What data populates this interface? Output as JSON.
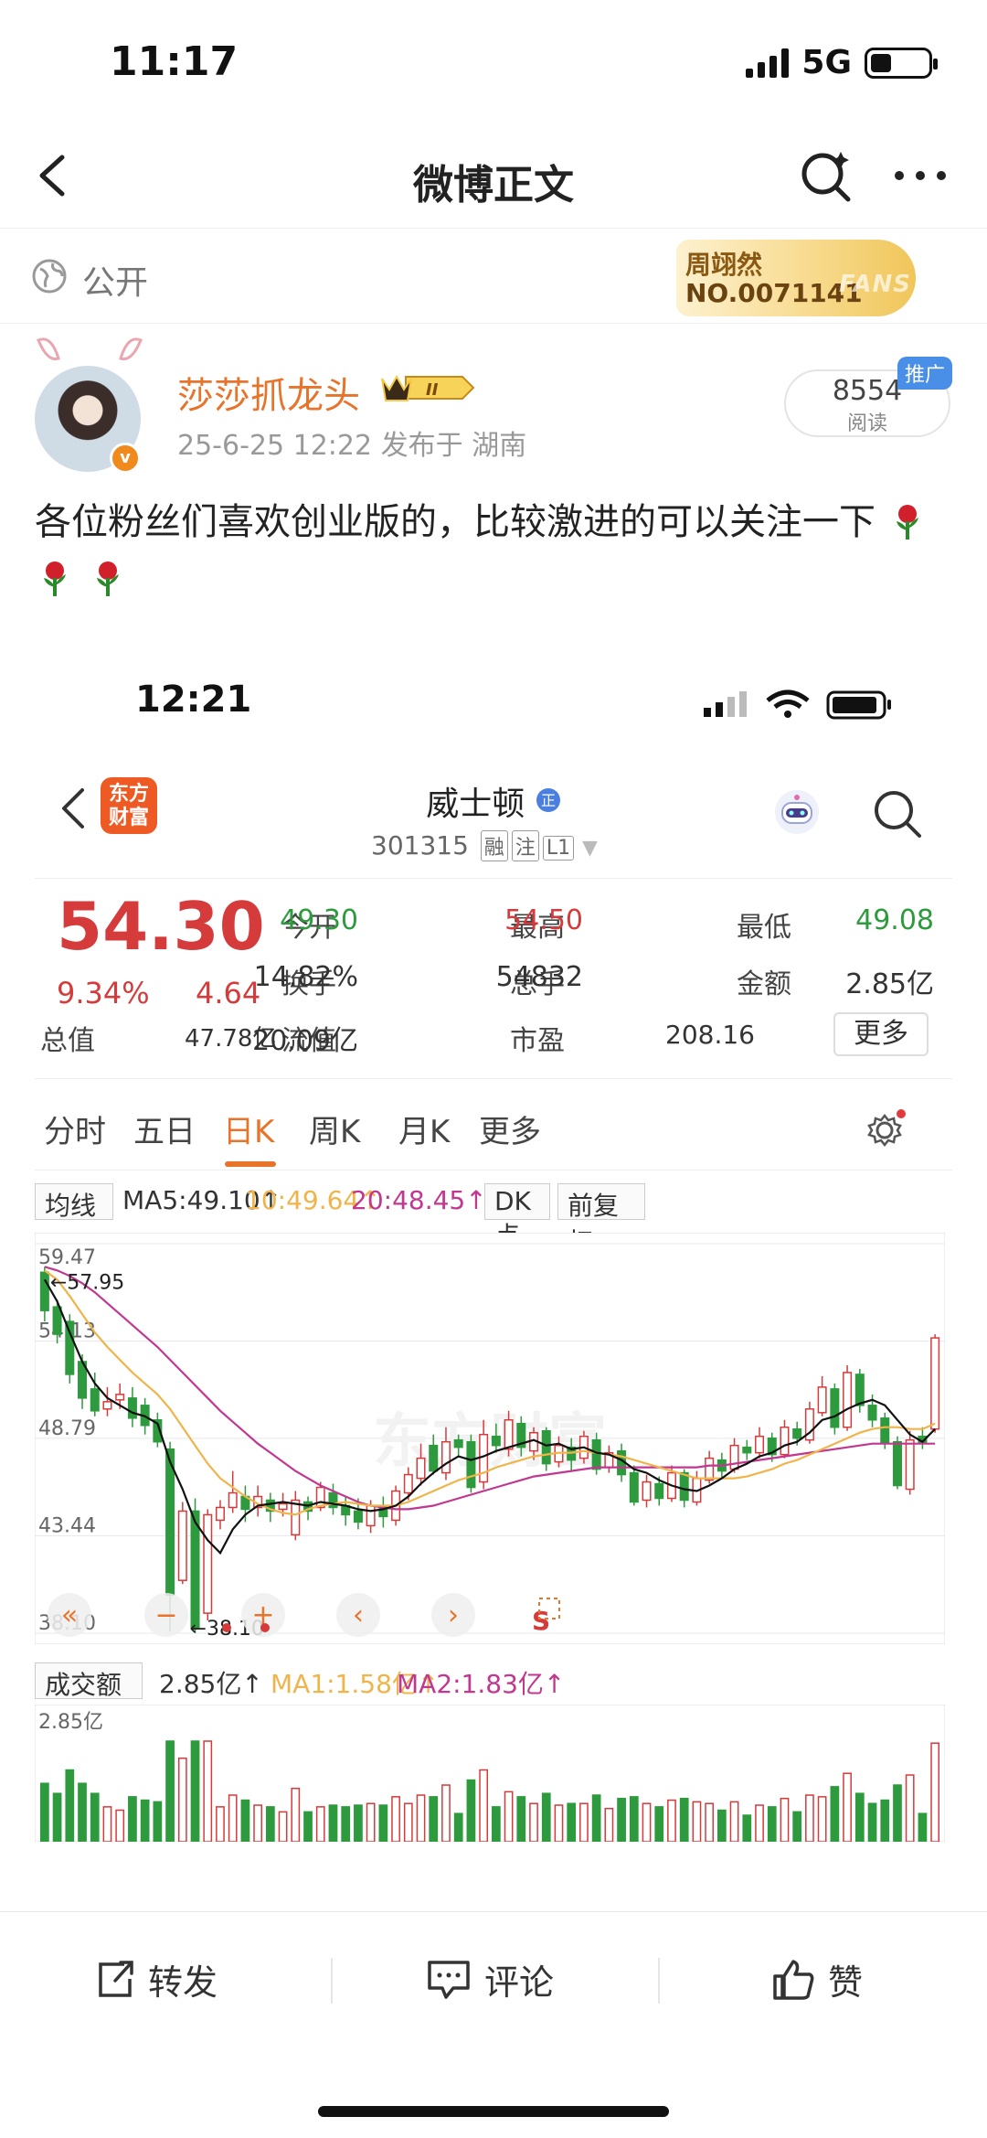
{
  "status_bar": {
    "time": "11:17",
    "network": "5G"
  },
  "nav": {
    "title": "微博正文"
  },
  "visibility": {
    "label": "公开"
  },
  "fans_badge": {
    "name": "周翊然",
    "number": "NO.0071141",
    "tag": "FANS"
  },
  "author": {
    "name": "莎莎抓龙头",
    "level": "II",
    "meta": "25-6-25 12:22  发布于 湖南",
    "reads": "8554",
    "reads_label": "阅读",
    "promo_tag": "推广"
  },
  "post": {
    "text": "各位粉丝们喜欢创业版的，比较激进的可以关注一下"
  },
  "screenshot": {
    "status_time": "12:21",
    "logo_text": "东方财富",
    "stock_name": "威士顿",
    "stock_code": "301315",
    "code_tags": [
      "融",
      "注",
      "L1"
    ],
    "price": "54.30",
    "change_pct": "9.34%",
    "change": "4.64",
    "fields": [
      {
        "label": "今开",
        "value": "49.30",
        "color": "green"
      },
      {
        "label": "最高",
        "value": "54.50",
        "color": "red"
      },
      {
        "label": "最低",
        "value": "49.08",
        "color": "green"
      },
      {
        "label": "换手",
        "value": "14.82%",
        "color": "dark"
      },
      {
        "label": "总手",
        "value": "54832",
        "color": "dark"
      },
      {
        "label": "金额",
        "value": "2.85亿",
        "color": "dark"
      },
      {
        "label": "总值",
        "value": "47.78亿",
        "color": "dark"
      },
      {
        "label": "流值",
        "value": "20.09亿",
        "color": "dark"
      },
      {
        "label": "市盈",
        "value": "208.16",
        "color": "dark"
      }
    ],
    "more_button": "更多",
    "tabs": [
      "分时",
      "五日",
      "日K",
      "周K",
      "月K",
      "更多"
    ],
    "active_tab": "日K",
    "ma_dropdown": "均线",
    "ma5": "MA5:49.10↑",
    "ma10": "10:49.64↑",
    "ma20": "20:48.45↑",
    "dk_button": "DK点",
    "fq_button": "前复权",
    "watermark": "东方财富",
    "vol_dropdown": "成交额",
    "vol_value": "2.85亿↑",
    "vol_ma1": "MA1:1.58亿↑",
    "vol_ma2": "MA2:1.83亿↑",
    "vol_axis_top": "2.85亿"
  },
  "chart_data": {
    "type": "candlestick",
    "y_ticks": [
      "59.47",
      "54.13",
      "48.79",
      "43.44",
      "38.10"
    ],
    "ylim": [
      38.1,
      59.47
    ],
    "annotations": {
      "high_label": "57.95",
      "low_label": "38.10"
    },
    "series_colors": {
      "up": "#d63b3b",
      "down": "#2e9a3e",
      "ma5": "#111111",
      "ma10": "#f0b44a",
      "ma20": "#c2378f"
    },
    "candles": [
      [
        57.9,
        55.8,
        58.2,
        55.2
      ],
      [
        56.0,
        54.5,
        56.4,
        54.0
      ],
      [
        55.2,
        52.3,
        55.6,
        51.8
      ],
      [
        53.0,
        51.0,
        53.4,
        50.4
      ],
      [
        51.5,
        50.3,
        52.4,
        50.0
      ],
      [
        50.4,
        50.8,
        51.6,
        50.0
      ],
      [
        50.9,
        51.2,
        51.8,
        50.4
      ],
      [
        51.0,
        49.9,
        51.6,
        49.4
      ],
      [
        50.6,
        49.5,
        51.0,
        49.0
      ],
      [
        49.8,
        48.6,
        50.2,
        48.3
      ],
      [
        48.2,
        40.2,
        48.6,
        38.2
      ],
      [
        41.0,
        44.8,
        45.3,
        40.8
      ],
      [
        44.8,
        38.4,
        45.5,
        38.1
      ],
      [
        39.2,
        44.6,
        44.9,
        38.8
      ],
      [
        44.3,
        45.0,
        45.4,
        43.8
      ],
      [
        45.0,
        45.8,
        47.0,
        44.7
      ],
      [
        45.6,
        44.9,
        46.2,
        44.2
      ],
      [
        45.0,
        45.6,
        46.2,
        44.5
      ],
      [
        45.4,
        44.8,
        45.8,
        44.2
      ],
      [
        44.9,
        45.2,
        45.8,
        44.5
      ],
      [
        43.5,
        45.4,
        45.9,
        43.2
      ],
      [
        45.3,
        44.8,
        45.6,
        44.3
      ],
      [
        45.0,
        46.1,
        46.4,
        44.8
      ],
      [
        45.8,
        45.0,
        46.3,
        44.6
      ],
      [
        45.1,
        44.6,
        45.6,
        44.0
      ],
      [
        44.8,
        44.2,
        45.5,
        43.8
      ],
      [
        44.0,
        45.1,
        45.4,
        43.6
      ],
      [
        45.0,
        44.5,
        45.6,
        43.9
      ],
      [
        44.3,
        45.9,
        46.2,
        44.0
      ],
      [
        45.8,
        46.8,
        47.2,
        45.4
      ],
      [
        46.6,
        47.7,
        48.5,
        46.2
      ],
      [
        48.4,
        47.0,
        49.0,
        46.8
      ],
      [
        46.9,
        48.6,
        49.4,
        46.5
      ],
      [
        48.7,
        48.3,
        49.0,
        47.8
      ],
      [
        48.6,
        46.1,
        49.0,
        45.8
      ],
      [
        46.4,
        49.0,
        49.8,
        46.0
      ],
      [
        48.9,
        48.4,
        49.6,
        48.0
      ],
      [
        48.2,
        49.8,
        50.3,
        47.8
      ],
      [
        49.6,
        48.3,
        50.0,
        47.8
      ],
      [
        48.1,
        49.1,
        49.4,
        47.6
      ],
      [
        49.2,
        47.4,
        49.4,
        47.0
      ],
      [
        47.5,
        48.4,
        48.9,
        47.2
      ],
      [
        48.3,
        47.6,
        48.8,
        47.0
      ],
      [
        47.7,
        48.9,
        49.2,
        47.4
      ],
      [
        48.7,
        47.1,
        49.1,
        46.8
      ],
      [
        47.2,
        48.0,
        48.4,
        46.9
      ],
      [
        48.1,
        46.8,
        48.5,
        46.4
      ],
      [
        46.9,
        45.3,
        47.3,
        45.1
      ],
      [
        45.4,
        46.4,
        46.8,
        45.0
      ],
      [
        46.3,
        45.5,
        46.7,
        45.1
      ],
      [
        45.5,
        46.9,
        47.3,
        45.3
      ],
      [
        46.9,
        45.4,
        47.1,
        45.0
      ],
      [
        45.3,
        46.6,
        47.0,
        45.1
      ],
      [
        46.5,
        47.7,
        48.1,
        46.3
      ],
      [
        47.6,
        47.0,
        48.0,
        46.6
      ],
      [
        47.1,
        48.4,
        48.8,
        46.9
      ],
      [
        48.3,
        48.0,
        48.7,
        47.6
      ],
      [
        48.0,
        48.9,
        49.4,
        47.7
      ],
      [
        48.8,
        47.9,
        49.1,
        47.5
      ],
      [
        47.9,
        49.4,
        49.8,
        47.7
      ],
      [
        49.3,
        48.8,
        49.7,
        48.4
      ],
      [
        48.7,
        50.4,
        50.8,
        48.5
      ],
      [
        50.2,
        51.6,
        52.2,
        50.0
      ],
      [
        51.5,
        49.4,
        51.8,
        49.0
      ],
      [
        49.4,
        52.4,
        52.8,
        49.2
      ],
      [
        52.3,
        50.6,
        52.6,
        50.2
      ],
      [
        50.6,
        49.8,
        51.2,
        49.4
      ],
      [
        49.9,
        48.5,
        50.2,
        48.2
      ],
      [
        48.6,
        46.2,
        48.9,
        46.0
      ],
      [
        46.0,
        48.7,
        49.2,
        45.7
      ],
      [
        48.9,
        48.5,
        49.4,
        48.2
      ],
      [
        49.3,
        54.3,
        54.5,
        49.1
      ]
    ],
    "ma5": [
      57.5,
      56.3,
      54.6,
      53.0,
      51.8,
      51.0,
      50.6,
      50.2,
      50.0,
      49.6,
      47.5,
      46.0,
      44.2,
      43.2,
      42.5,
      43.8,
      44.6,
      45.1,
      45.2,
      45.3,
      45.2,
      45.1,
      45.3,
      45.2,
      45.1,
      44.9,
      44.8,
      44.9,
      45.1,
      45.6,
      46.3,
      46.9,
      47.4,
      47.8,
      47.6,
      47.8,
      48.1,
      48.3,
      48.5,
      48.7,
      48.4,
      48.5,
      48.2,
      48.3,
      48.0,
      47.9,
      47.6,
      47.1,
      46.9,
      46.5,
      46.2,
      46.0,
      45.9,
      46.2,
      46.6,
      47.1,
      47.4,
      47.8,
      48.0,
      48.4,
      48.6,
      49.1,
      49.8,
      50.0,
      50.4,
      50.7,
      50.9,
      50.6,
      49.8,
      49.0,
      48.6,
      49.3
    ],
    "ma10": [
      58.0,
      57.5,
      56.6,
      55.6,
      54.6,
      53.8,
      53.1,
      52.4,
      51.8,
      51.2,
      50.4,
      49.4,
      48.4,
      47.4,
      46.6,
      46.1,
      45.6,
      45.2,
      44.9,
      44.7,
      44.6,
      44.9,
      45.1,
      45.2,
      45.3,
      45.2,
      45.1,
      45.1,
      45.1,
      45.3,
      45.6,
      45.9,
      46.2,
      46.5,
      46.7,
      46.9,
      47.2,
      47.4,
      47.6,
      47.8,
      47.9,
      48.0,
      48.0,
      48.1,
      48.0,
      47.9,
      47.8,
      47.6,
      47.4,
      47.2,
      47.0,
      46.8,
      46.6,
      46.6,
      46.6,
      46.6,
      46.7,
      46.9,
      47.1,
      47.4,
      47.6,
      47.9,
      48.2,
      48.5,
      48.8,
      49.1,
      49.3,
      49.4,
      49.4,
      49.3,
      49.3,
      49.6
    ],
    "ma20": [
      58.2,
      58.0,
      57.7,
      57.3,
      56.8,
      56.2,
      55.6,
      55.0,
      54.4,
      53.8,
      53.1,
      52.4,
      51.7,
      51.0,
      50.3,
      49.7,
      49.1,
      48.5,
      48.0,
      47.5,
      47.0,
      46.6,
      46.2,
      45.9,
      45.6,
      45.3,
      45.1,
      45.0,
      44.9,
      44.9,
      45.0,
      45.1,
      45.3,
      45.5,
      45.7,
      45.9,
      46.1,
      46.3,
      46.5,
      46.7,
      46.8,
      46.9,
      47.0,
      47.1,
      47.2,
      47.2,
      47.2,
      47.2,
      47.2,
      47.2,
      47.2,
      47.2,
      47.2,
      47.3,
      47.3,
      47.4,
      47.5,
      47.6,
      47.7,
      47.8,
      47.9,
      48.0,
      48.1,
      48.2,
      48.3,
      48.4,
      48.5,
      48.5,
      48.5,
      48.5,
      48.5,
      48.5
    ]
  },
  "bottom_bar": {
    "repost": "转发",
    "comment": "评论",
    "like": "赞"
  }
}
